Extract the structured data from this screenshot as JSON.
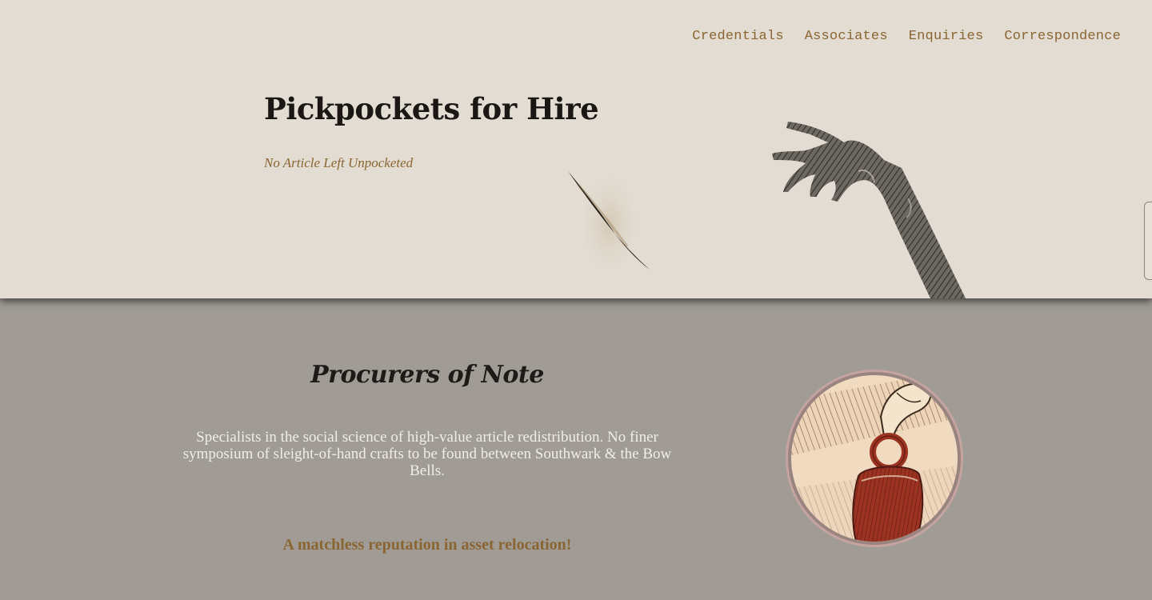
{
  "nav": {
    "items": [
      "Credentials",
      "Associates",
      "Enquiries",
      "Correspondence"
    ]
  },
  "hero": {
    "title": "Pickpockets for Hire",
    "tagline": "No Article Left Unpocketed"
  },
  "section": {
    "title": "Procurers of Note",
    "body": "Specialists in the social science of high-value article redistribution. No finer symposium of sleight-of-hand crafts to be found between Southwark & the Bow Bells.",
    "accent": "A matchless reputation in asset relocation!"
  },
  "colors": {
    "hero_bg": "#e2dcd2",
    "section_bg": "#a09c95",
    "accent": "#8a6532",
    "heading": "#1a1715",
    "body_text": "#f1ede6"
  },
  "icons": {
    "slash": "blade-slash-icon",
    "hand": "reaching-hand-illustration",
    "medallion": "pickpocket-purse-illustration"
  }
}
